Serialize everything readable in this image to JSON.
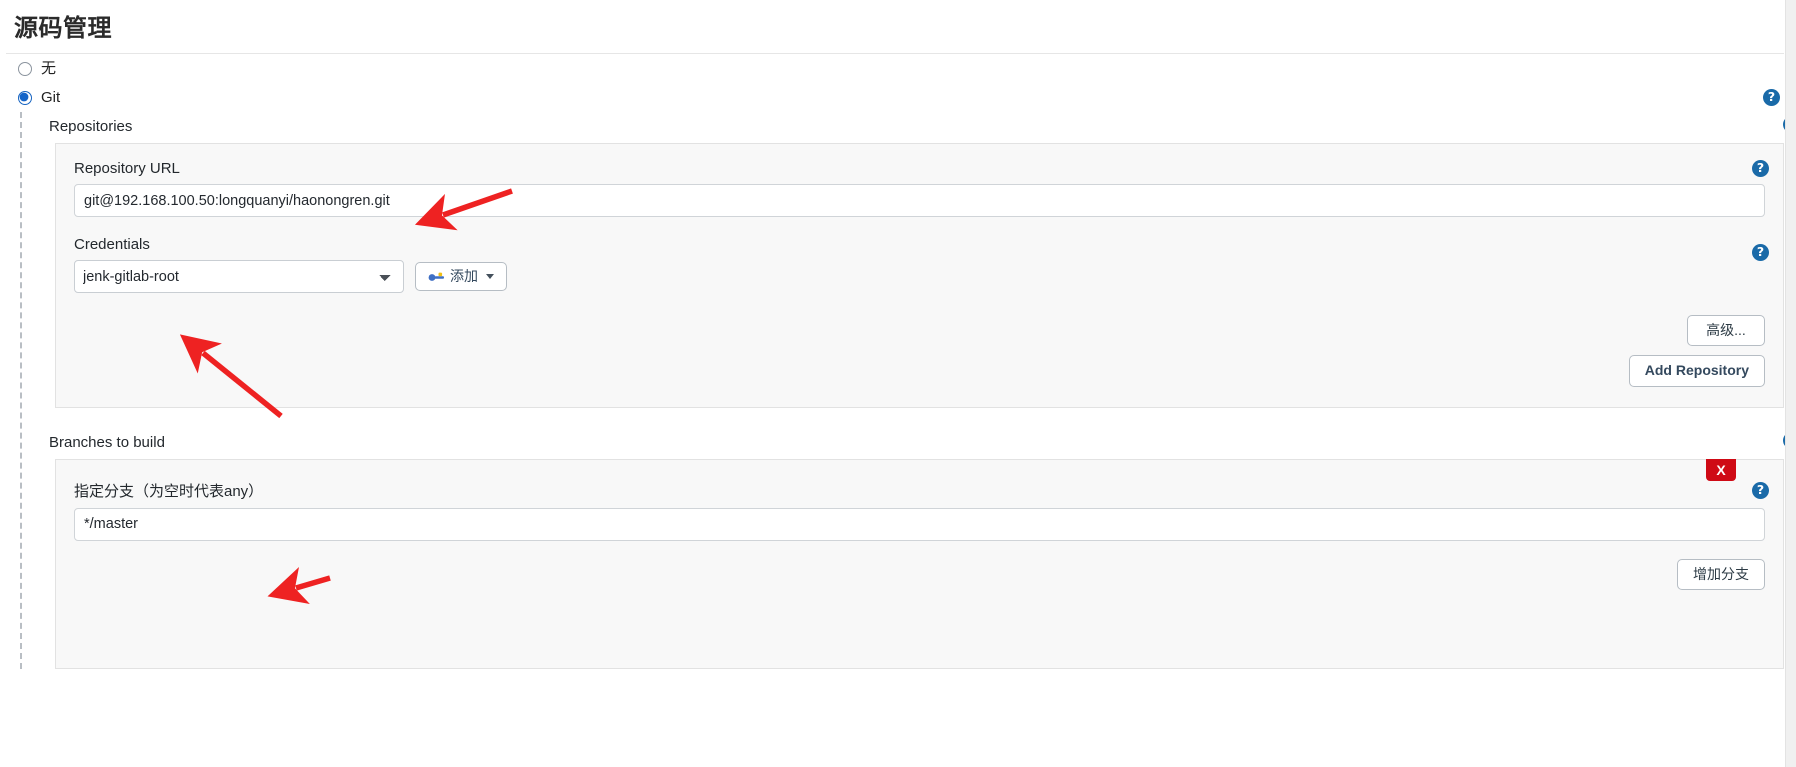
{
  "header": {
    "title": "源码管理"
  },
  "scm_options": [
    {
      "label": "无",
      "selected": false
    },
    {
      "label": "Git",
      "selected": true
    }
  ],
  "repositories": {
    "section_label": "Repositories",
    "repository_url": {
      "label": "Repository URL",
      "value": "git@192.168.100.50:longquanyi/haonongren.git"
    },
    "credentials": {
      "label": "Credentials",
      "selected": "jenk-gitlab-root",
      "options": [
        "jenk-gitlab-root"
      ],
      "add_button": "添加"
    },
    "advanced_button": "高级...",
    "add_repository_button": "Add Repository"
  },
  "branches": {
    "section_label": "Branches to build",
    "branch_specifier": {
      "label": "指定分支（为空时代表any）",
      "value": "*/master"
    },
    "delete_button": "X",
    "add_branch_button": "增加分支"
  },
  "help_icon": "?",
  "colors": {
    "accent": "#1565c8",
    "help_blue": "#1a6aa8",
    "danger_red": "#cf0a15",
    "annotation_red": "#ee2222",
    "panel_bg": "#f8f8f8",
    "panel_border": "#e2e2e2"
  }
}
